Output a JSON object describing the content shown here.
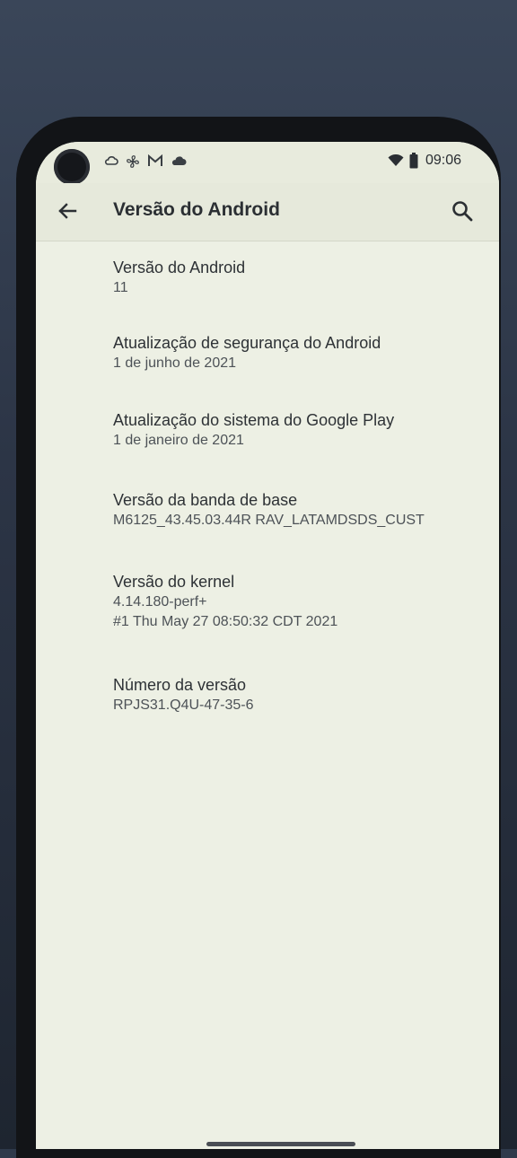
{
  "status_bar": {
    "time": "09:06",
    "left_icons": [
      "cloud-icon",
      "fan-icon",
      "gmail-icon",
      "cloud-filled-icon"
    ],
    "right_icons": [
      "wifi-icon",
      "battery-icon"
    ]
  },
  "app_bar": {
    "title": "Versão do Android"
  },
  "items": [
    {
      "title": "Versão do Android",
      "subtitle": "11"
    },
    {
      "title": "Atualização de segurança do Android",
      "subtitle": "1 de junho de 2021"
    },
    {
      "title": "Atualização do sistema do Google Play",
      "subtitle": "1 de janeiro de 2021"
    },
    {
      "title": "Versão da banda de base",
      "subtitle": "M6125_43.45.03.44R RAV_LATAMDSDS_CUST"
    },
    {
      "title": "Versão do kernel",
      "subtitle": "4.14.180-perf+\n#1 Thu May 27 08:50:32 CDT 2021"
    },
    {
      "title": "Número da versão",
      "subtitle": "RPJS31.Q4U-47-35-6"
    }
  ]
}
